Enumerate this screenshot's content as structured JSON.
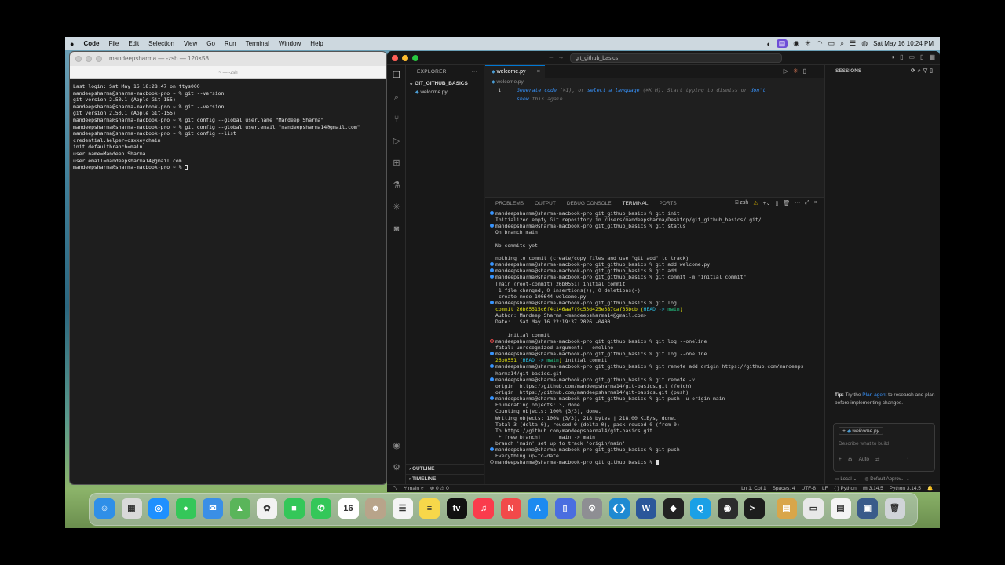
{
  "menubar": {
    "apple": "",
    "app": "Code",
    "items": [
      "File",
      "Edit",
      "Selection",
      "View",
      "Go",
      "Run",
      "Terminal",
      "Window",
      "Help"
    ],
    "datetime": "Sat May 16  10:24 PM"
  },
  "terminal": {
    "title": "mandeepsharma — -zsh — 120×58",
    "tab": "~ — -zsh",
    "lines": [
      "Last login: Sat May 16 18:28:47 on ttys000",
      "mandeepsharma@sharma-macbook-pro ~ % git --version",
      "git version 2.50.1 (Apple Git-155)",
      "mandeepsharma@sharma-macbook-pro ~ % git --version",
      "git version 2.50.1 (Apple Git-155)",
      "mandeepsharma@sharma-macbook-pro ~ % git config --global user.name \"Mandeep Sharma\"",
      "mandeepsharma@sharma-macbook-pro ~ % git config --global user.email \"mandeepsharma14@gmail.com\"",
      "mandeepsharma@sharma-macbook-pro ~ % git config --list",
      "credential.helper=osxkeychain",
      "init.defaultbranch=main",
      "user.name=Mandeep Sharma",
      "user.email=mandeepsharma14@gmail.com",
      "mandeepsharma@sharma-macbook-pro ~ % "
    ]
  },
  "vscode": {
    "search": "git_github_basics",
    "explorer": {
      "header": "EXPLORER",
      "folder": "GIT_GITHUB_BASICS",
      "file": "welcome.py",
      "outline": "OUTLINE",
      "timeline": "TIMELINE"
    },
    "editor": {
      "tab": "welcome.py",
      "breadcrumb": "welcome.py",
      "line_no": "1",
      "hint1_a": "Generate code",
      "hint1_b": " (⌘I), or ",
      "hint1_c": "select a language",
      "hint1_d": " (⌘K M). Start typing to dismiss or ",
      "hint1_e": "don't",
      "hint2_a": "show",
      "hint2_b": " this again."
    },
    "panel": {
      "tabs": [
        "PROBLEMS",
        "OUTPUT",
        "DEBUG CONSOLE",
        "TERMINAL",
        "PORTS"
      ],
      "active_tab": "TERMINAL",
      "shell": "zsh"
    },
    "terminal_lines": [
      {
        "m": "b",
        "t": "mandeepsharma@sharma-macbook-pro git_github_basics % git init"
      },
      {
        "m": "",
        "t": "Initialized empty Git repository in /Users/mandeepsharma/Desktop/git_github_basics/.git/"
      },
      {
        "m": "b",
        "t": "mandeepsharma@sharma-macbook-pro git_github_basics % git status"
      },
      {
        "m": "",
        "t": "On branch main"
      },
      {
        "m": "",
        "t": ""
      },
      {
        "m": "",
        "t": "No commits yet"
      },
      {
        "m": "",
        "t": ""
      },
      {
        "m": "",
        "t": "nothing to commit (create/copy files and use \"git add\" to track)"
      },
      {
        "m": "b",
        "t": "mandeepsharma@sharma-macbook-pro git_github_basics % git add welcome.py"
      },
      {
        "m": "b",
        "t": "mandeepsharma@sharma-macbook-pro git_github_basics % git add ."
      },
      {
        "m": "b",
        "t": "mandeepsharma@sharma-macbook-pro git_github_basics % git commit -m \"initial commit\""
      },
      {
        "m": "",
        "t": "[main (root-commit) 26b0551] initial commit"
      },
      {
        "m": "",
        "t": " 1 file changed, 0 insertions(+), 0 deletions(-)"
      },
      {
        "m": "",
        "t": " create mode 100644 welcome.py"
      },
      {
        "m": "b",
        "t": "mandeepsharma@sharma-macbook-pro git_github_basics % git log"
      },
      {
        "m": "",
        "t": "commit 26b05515c6f4c146aa7f9c53d425e387caf35bcb (HEAD -> main)",
        "s": "commit"
      },
      {
        "m": "",
        "t": "Author: Mandeep Sharma <mandeepsharma14@gmail.com>"
      },
      {
        "m": "",
        "t": "Date:   Sat May 16 22:19:37 2026 -0400"
      },
      {
        "m": "",
        "t": ""
      },
      {
        "m": "",
        "t": "    initial commit"
      },
      {
        "m": "r",
        "t": "mandeepsharma@sharma-macbook-pro git_github_basics % git log --oneline"
      },
      {
        "m": "",
        "t": "fatal: unrecognized argument: --oneline"
      },
      {
        "m": "b",
        "t": "mandeepsharma@sharma-macbook-pro git_github_basics % git log --oneline"
      },
      {
        "m": "",
        "t": "26b0551 (HEAD -> main) initial commit",
        "s": "short"
      },
      {
        "m": "b",
        "t": "mandeepsharma@sharma-macbook-pro git_github_basics % git remote add origin https://github.com/mandeeps"
      },
      {
        "m": "",
        "t": "harma14/git-basics.git"
      },
      {
        "m": "b",
        "t": "mandeepsharma@sharma-macbook-pro git_github_basics % git remote -v"
      },
      {
        "m": "",
        "t": "origin  https://github.com/mandeepsharma14/git-basics.git (fetch)"
      },
      {
        "m": "",
        "t": "origin  https://github.com/mandeepsharma14/git-basics.git (push)"
      },
      {
        "m": "b",
        "t": "mandeepsharma@sharma-macbook-pro git_github_basics % git push -u origin main"
      },
      {
        "m": "",
        "t": "Enumerating objects: 3, done."
      },
      {
        "m": "",
        "t": "Counting objects: 100% (3/3), done."
      },
      {
        "m": "",
        "t": "Writing objects: 100% (3/3), 218 bytes | 218.00 KiB/s, done."
      },
      {
        "m": "",
        "t": "Total 3 (delta 0), reused 0 (delta 0), pack-reused 0 (from 0)"
      },
      {
        "m": "",
        "t": "To https://github.com/mandeepsharma14/git-basics.git"
      },
      {
        "m": "",
        "t": " * [new branch]      main -> main"
      },
      {
        "m": "",
        "t": "branch 'main' set up to track 'origin/main'."
      },
      {
        "m": "b",
        "t": "mandeepsharma@sharma-macbook-pro git_github_basics % git push"
      },
      {
        "m": "",
        "t": "Everything up-to-date"
      },
      {
        "m": "g",
        "t": "mandeepsharma@sharma-macbook-pro git_github_basics % "
      }
    ],
    "sessions": {
      "header": "SESSIONS",
      "tip_label": "Tip:",
      "tip_a": " Try the ",
      "tip_link": "Plan agent",
      "tip_b": " to research and plan before implementing changes.",
      "context_file": "welcome.py",
      "placeholder": "Describe what to build",
      "auto": "Auto",
      "local": "Local",
      "approvals": "Default Approv..."
    },
    "statusbar": {
      "branch": "main",
      "errors": "0",
      "warnings": "0",
      "position": "Ln 1, Col 1",
      "spaces": "Spaces: 4",
      "encoding": "UTF-8",
      "eol": "LF",
      "language": "Python",
      "version": "3.14.5",
      "interpreter": "Python 3.14.5"
    }
  },
  "dock": {
    "apps": [
      {
        "name": "finder",
        "color": "#2f8fe8",
        "glyph": "☺"
      },
      {
        "name": "launchpad",
        "color": "#d9d9d9",
        "glyph": "▦"
      },
      {
        "name": "safari",
        "color": "#1e90ff",
        "glyph": "◎"
      },
      {
        "name": "messages",
        "color": "#34c759",
        "glyph": "●"
      },
      {
        "name": "mail",
        "color": "#3a8fe6",
        "glyph": "✉"
      },
      {
        "name": "maps",
        "color": "#5ab55a",
        "glyph": "▲"
      },
      {
        "name": "photos",
        "color": "#f2f2f2",
        "glyph": "✿"
      },
      {
        "name": "facetime",
        "color": "#34c759",
        "glyph": "■"
      },
      {
        "name": "phone",
        "color": "#34c759",
        "glyph": "✆"
      },
      {
        "name": "calendar",
        "color": "#ffffff",
        "glyph": "16"
      },
      {
        "name": "contacts",
        "color": "#b8a48a",
        "glyph": "☻"
      },
      {
        "name": "reminders",
        "color": "#f4f4f4",
        "glyph": "☰"
      },
      {
        "name": "notes",
        "color": "#f7d74a",
        "glyph": "≡"
      },
      {
        "name": "tv",
        "color": "#111111",
        "glyph": "tv"
      },
      {
        "name": "music",
        "color": "#fa3c4c",
        "glyph": "♫"
      },
      {
        "name": "news",
        "color": "#f24a4a",
        "glyph": "N"
      },
      {
        "name": "app-store",
        "color": "#1c8af0",
        "glyph": "A"
      },
      {
        "name": "iphone-mirroring",
        "color": "#4a6ee0",
        "glyph": "▯"
      },
      {
        "name": "system-settings",
        "color": "#8e8e93",
        "glyph": "⚙"
      },
      {
        "name": "vscode",
        "color": "#1f8ad2",
        "glyph": "❮❯"
      },
      {
        "name": "word",
        "color": "#2b579a",
        "glyph": "W"
      },
      {
        "name": "cube-app",
        "color": "#222222",
        "glyph": "◆"
      },
      {
        "name": "quick-app",
        "color": "#1aa0e6",
        "glyph": "Q"
      },
      {
        "name": "activity-app",
        "color": "#2c2c2c",
        "glyph": "◉"
      },
      {
        "name": "terminal",
        "color": "#1d1d1d",
        "glyph": ">_"
      },
      {
        "name": "archive",
        "color": "#d9a64a",
        "glyph": "▤"
      },
      {
        "name": "preview",
        "color": "#e8e8e8",
        "glyph": "▭"
      },
      {
        "name": "document",
        "color": "#f4f4f4",
        "glyph": "▤"
      },
      {
        "name": "screenshot",
        "color": "#3a5b8a",
        "glyph": "▣"
      },
      {
        "name": "trash",
        "color": "#d0d4d8",
        "glyph": "🗑"
      }
    ]
  }
}
